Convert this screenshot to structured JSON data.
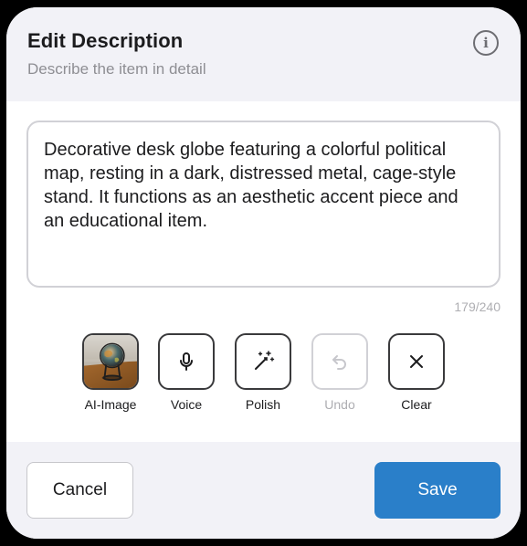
{
  "dialog": {
    "title": "Edit Description",
    "subtitle": "Describe the item in detail",
    "info_icon": "info-circle-icon"
  },
  "description": {
    "text": "Decorative desk globe featuring a colorful political map, resting in a dark, distressed metal, cage-style stand. It functions as an aesthetic accent piece and an educational item.",
    "char_count": "179/240"
  },
  "tools": [
    {
      "label": "AI-Image",
      "icon": "globe-thumbnail",
      "enabled": true
    },
    {
      "label": "Voice",
      "icon": "microphone-icon",
      "enabled": true
    },
    {
      "label": "Polish",
      "icon": "magic-wand-icon",
      "enabled": true
    },
    {
      "label": "Undo",
      "icon": "undo-icon",
      "enabled": false
    },
    {
      "label": "Clear",
      "icon": "close-icon",
      "enabled": true
    }
  ],
  "footer": {
    "cancel_label": "Cancel",
    "save_label": "Save"
  },
  "colors": {
    "accent": "#2a7fc9",
    "background": "#f2f2f7",
    "border": "#d1d1d6",
    "muted_text": "#8e8e93"
  }
}
